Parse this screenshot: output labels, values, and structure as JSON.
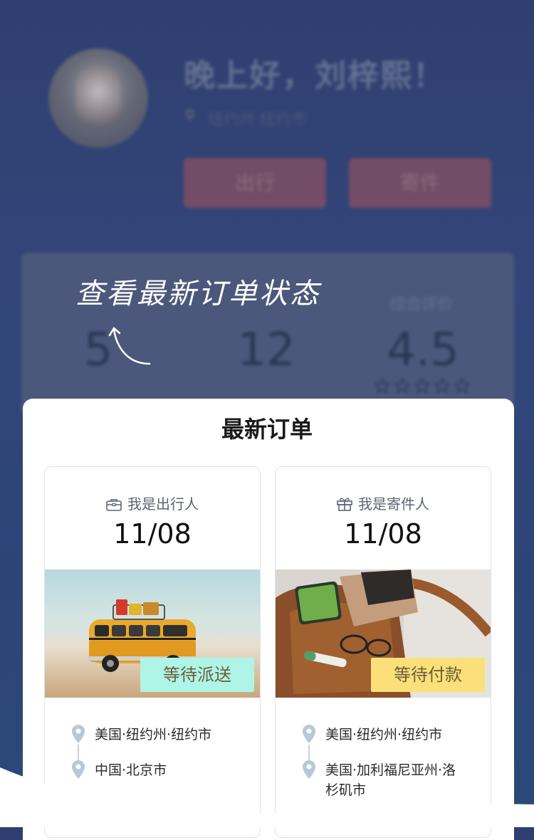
{
  "profile": {
    "greeting": "晚上好，刘梓熙！",
    "location": "纽约州·纽约市",
    "buttons": [
      "出行",
      "寄件"
    ]
  },
  "stats": {
    "labels": [
      "",
      "",
      "综合评价"
    ],
    "values": [
      "5",
      "12",
      "4.5"
    ],
    "rating_fraction": 0.9
  },
  "hint": {
    "text": "查看最新订单状态"
  },
  "latest_orders": {
    "title": "最新订单",
    "orders": [
      {
        "role": "我是出行人",
        "role_icon": "briefcase-icon",
        "date": "11/08",
        "status": "等待派送",
        "status_color": "#aef5e8",
        "from": "美国·纽约州·纽约市",
        "to": "中国·北京市"
      },
      {
        "role": "我是寄件人",
        "role_icon": "gift-icon",
        "date": "11/08",
        "status": "等待付款",
        "status_color": "#fbe07a",
        "from": "美国·纽约州·纽约市",
        "to": "美国·加利福尼亚州·洛杉矶市"
      }
    ]
  }
}
